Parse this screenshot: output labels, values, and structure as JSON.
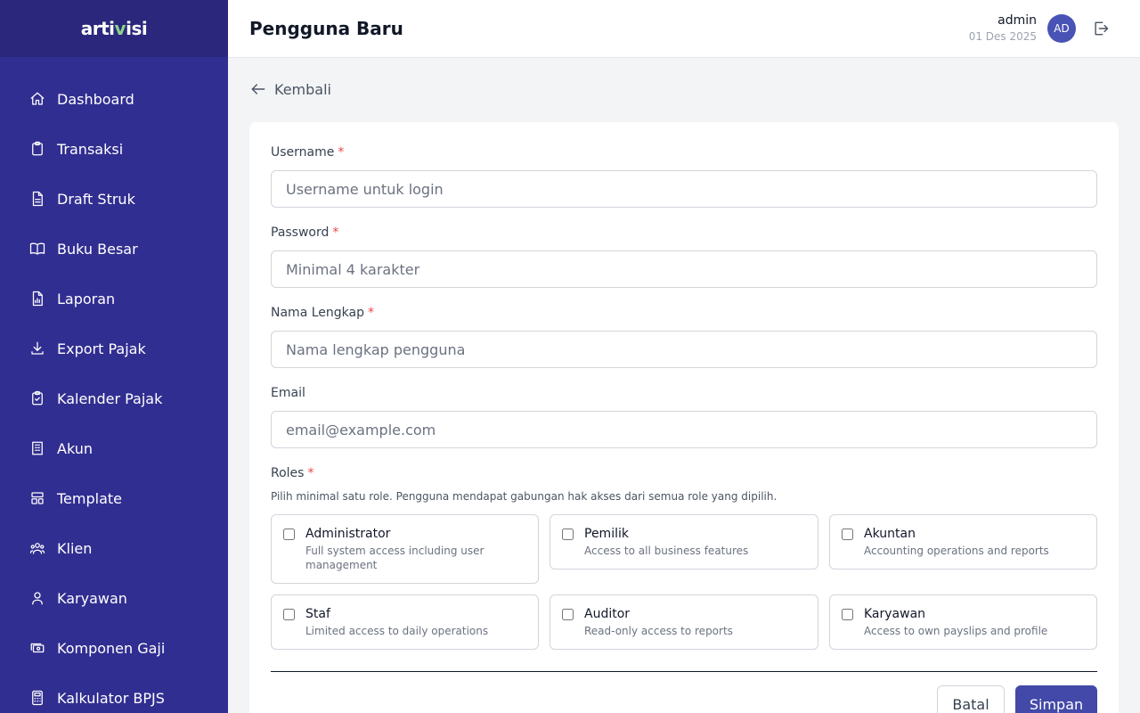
{
  "app": {
    "logo_text": "artivisi",
    "accent_color": "#312e91"
  },
  "sidebar": {
    "items": [
      {
        "label": "Dashboard",
        "icon": "home-icon"
      },
      {
        "label": "Transaksi",
        "icon": "clipboard-icon"
      },
      {
        "label": "Draft Struk",
        "icon": "document-icon"
      },
      {
        "label": "Buku Besar",
        "icon": "book-icon"
      },
      {
        "label": "Laporan",
        "icon": "report-icon"
      },
      {
        "label": "Export Pajak",
        "icon": "download-icon"
      },
      {
        "label": "Kalender Pajak",
        "icon": "clipboard-check-icon"
      },
      {
        "label": "Akun",
        "icon": "building-icon"
      },
      {
        "label": "Template",
        "icon": "template-icon"
      },
      {
        "label": "Klien",
        "icon": "users-icon"
      },
      {
        "label": "Karyawan",
        "icon": "user-icon"
      },
      {
        "label": "Komponen Gaji",
        "icon": "cash-icon"
      },
      {
        "label": "Kalkulator BPJS",
        "icon": "calculator-icon"
      }
    ]
  },
  "header": {
    "title": "Pengguna Baru",
    "user_name": "admin",
    "date": "01 Des 2025",
    "avatar_initials": "AD"
  },
  "back_label": "Kembali",
  "form": {
    "username": {
      "label": "Username",
      "required": "*",
      "placeholder": "Username untuk login",
      "value": ""
    },
    "password": {
      "label": "Password",
      "required": "*",
      "placeholder": "Minimal 4 karakter",
      "value": ""
    },
    "full_name": {
      "label": "Nama Lengkap",
      "required": "*",
      "placeholder": "Nama lengkap pengguna",
      "value": ""
    },
    "email": {
      "label": "Email",
      "placeholder": "email@example.com",
      "value": ""
    },
    "roles": {
      "label": "Roles",
      "required": "*",
      "help": "Pilih minimal satu role. Pengguna mendapat gabungan hak akses dari semua role yang dipilih.",
      "options": [
        {
          "name": "Administrator",
          "description": "Full system access including user management",
          "checked": false
        },
        {
          "name": "Pemilik",
          "description": "Access to all business features",
          "checked": false
        },
        {
          "name": "Akuntan",
          "description": "Accounting operations and reports",
          "checked": false
        },
        {
          "name": "Staf",
          "description": "Limited access to daily operations",
          "checked": false
        },
        {
          "name": "Auditor",
          "description": "Read-only access to reports",
          "checked": false
        },
        {
          "name": "Karyawan",
          "description": "Access to own payslips and profile",
          "checked": false
        }
      ]
    },
    "cancel_label": "Batal",
    "save_label": "Simpan"
  }
}
